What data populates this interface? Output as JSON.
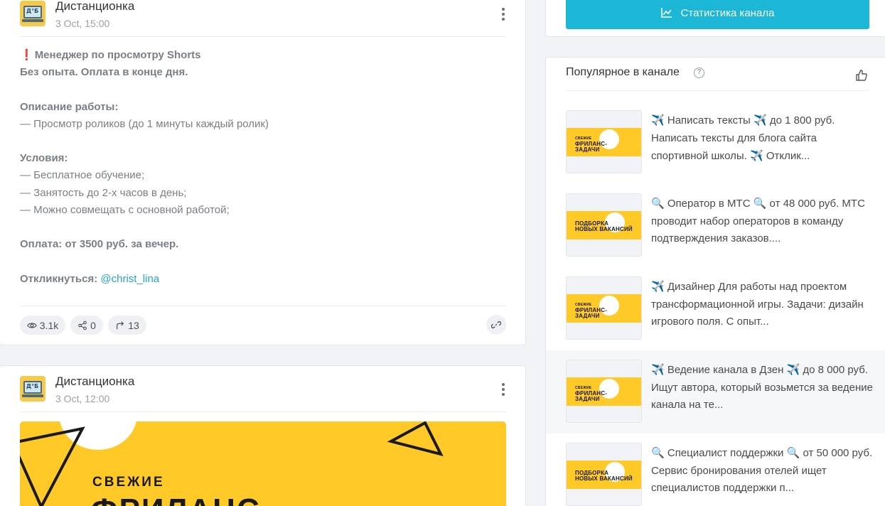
{
  "post1": {
    "channel": "Дистанционка",
    "date": "3 Oct, 15:00",
    "exclaim": "❗",
    "title": "Менеджер по просмотру Shorts",
    "subtitle": "Без опыта. Оплата в конце дня.",
    "desc_heading": "Описание работы:",
    "desc_line": "— Просмотр роликов (до 1 минуты каждый ролик)",
    "cond_heading": "Условия:",
    "cond_lines": [
      "— Бесплатное обучение;",
      "— Занятость до 2-х часов в день;",
      "— Можно совмещать с основной работой;"
    ],
    "pay": "Оплата: от 3500 руб. за вечер.",
    "respond_label": "Откликнуться:",
    "respond_handle": "@christ_lina",
    "views": "3.1k",
    "shares": "0",
    "forwards": "13"
  },
  "post2": {
    "channel": "Дистанционка",
    "date": "3 Oct, 12:00",
    "hero_line1": "СВЕЖИЕ",
    "hero_line2": "ФРИЛАНС"
  },
  "sidebar": {
    "stats_button": "Статистика канала",
    "popular_title": "Популярное в канале",
    "items": [
      {
        "thumb": [
          "СВЕЖИЕ",
          "ФРИЛАНС-",
          "ЗАДАЧИ"
        ],
        "e1": "✈️",
        "text": " Написать тексты ",
        "e2": "✈️",
        "rest": " до 1 800 руб. Написать тексты для блога сайта спортивной школы. ",
        "e3": "✈️",
        "end": " Отклик..."
      },
      {
        "thumb": [
          "ПОДБОРКА",
          "НОВЫХ ВАКАНСИЙ"
        ],
        "e1": "🔍",
        "text": " Оператор в МТС ",
        "e2": "🔍",
        "rest": " от 48 000 руб. МТС проводит набор операторов в команду подтверждения заказов....",
        "e3": "",
        "end": ""
      },
      {
        "thumb": [
          "СВЕЖИЕ",
          "ФРИЛАНС-",
          "ЗАДАЧИ"
        ],
        "e1": "✈️",
        "text": " Дизайнер Для работы над проектом трансформационной игры. Задачи: дизайн игрового поля. С опыт...",
        "e2": "",
        "rest": "",
        "e3": "",
        "end": ""
      },
      {
        "thumb": [
          "СВЕЖИЕ",
          "ФРИЛАНС-",
          "ЗАДАЧИ"
        ],
        "e1": "✈️",
        "text": " Ведение канала в Дзен ",
        "e2": "✈️",
        "rest": " до 8 000 руб. Ищут автора, который возьмется за ведение канала на те...",
        "e3": "",
        "end": ""
      },
      {
        "thumb": [
          "ПОДБОРКА",
          "НОВЫХ ВАКАНСИЙ"
        ],
        "e1": "🔍",
        "text": " Специалист поддержки ",
        "e2": "🔍",
        "rest": " от 50 000 руб. Сервис бронирования отелей ищет специалистов поддержки п...",
        "e3": "",
        "end": ""
      }
    ]
  }
}
